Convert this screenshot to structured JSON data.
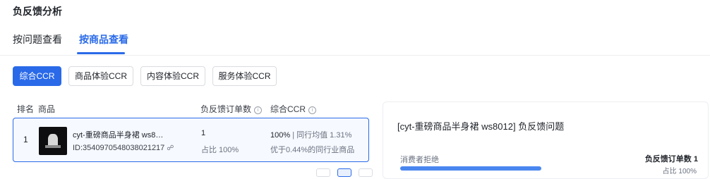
{
  "page_title": "负反馈分析",
  "tabs": [
    {
      "label": "按问题查看",
      "active": false
    },
    {
      "label": "按商品查看",
      "active": true
    }
  ],
  "filters": [
    {
      "label": "综合CCR",
      "active": true
    },
    {
      "label": "商品体验CCR",
      "active": false
    },
    {
      "label": "内容体验CCR",
      "active": false
    },
    {
      "label": "服务体验CCR",
      "active": false
    }
  ],
  "table": {
    "headers": {
      "rank": "排名",
      "product": "商品",
      "neg_orders": "负反馈订单数",
      "ccr": "综合CCR"
    },
    "rows": [
      {
        "rank": "1",
        "product_name": "cyt-重磅商品半身裙 ws8…",
        "product_id": "ID:3540970548038021217",
        "neg_orders": "1",
        "neg_ratio": "占比 100%",
        "ccr": "100%",
        "peer_avg": "同行均值 1.31%",
        "peer_compare": "优于0.44%的同行业商品"
      }
    ]
  },
  "detail_panel": {
    "title": "[cyt-重磅商品半身裙 ws8012] 负反馈问题",
    "left_label": "消费者拒绝",
    "right_label": "负反馈订单数 1",
    "ratio": "占比 100%",
    "bar_fraction": 1.0
  },
  "colors": {
    "accent": "#2a6ae9",
    "row_bg": "#f6f9ff"
  }
}
